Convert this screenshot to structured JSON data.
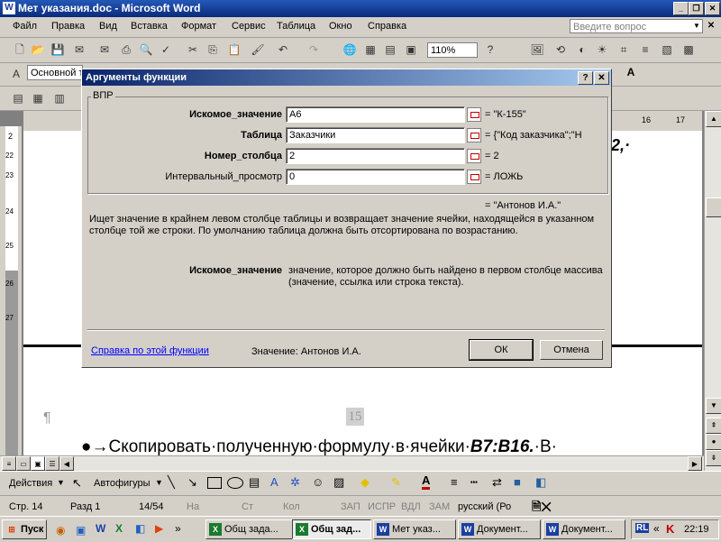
{
  "window": {
    "title": "Мет указания.doc - Microsoft Word",
    "app_icon": "W"
  },
  "menu": [
    "Файл",
    "Правка",
    "Вид",
    "Вставка",
    "Формат",
    "Сервис",
    "Таблица",
    "Окно",
    "Справка"
  ],
  "help_box": {
    "placeholder": "Введите вопрос"
  },
  "toolbar": {
    "zoom": "110%",
    "style": "Основной т"
  },
  "ruler": {
    "h_marks": [
      "16",
      "17"
    ],
    "v_marks": [
      "2",
      "22",
      "23",
      "24",
      "25",
      "26",
      "27"
    ]
  },
  "document": {
    "visible_fragment": "2,·",
    "paragraph_mark": "¶",
    "page_number": "15",
    "bullet_text": "●→Скопировать·полученную·формулу·в·ячейки·",
    "bullet_bold": "B7:B16.",
    "bullet_tail": "·В·"
  },
  "dialog": {
    "title": "Аргументы функции",
    "function_name": "ВПР",
    "args": [
      {
        "label": "Искомое_значение",
        "bold": true,
        "value": "A6",
        "result": "= \"К-155\""
      },
      {
        "label": "Таблица",
        "bold": true,
        "value": "Заказчики",
        "result": "= {\"Код заказчика\";\"Н"
      },
      {
        "label": "Номер_столбца",
        "bold": true,
        "value": "2",
        "result": "= 2"
      },
      {
        "label": "Интервальный_просмотр",
        "bold": false,
        "value": "0",
        "result": "= ЛОЖЬ"
      }
    ],
    "formula_result": "= \"Антонов И.А.\"",
    "description": "Ищет значение в крайнем левом столбце таблицы и возвращает значение ячейки, находящейся в указанном столбце той же строки. По умолчанию таблица должна быть отсортирована по возрастанию.",
    "arg_help_name": "Искомое_значение",
    "arg_help_text": "значение, которое должно быть найдено в первом столбце массива (значение, ссылка или строка текста).",
    "help_link": "Справка по этой функции",
    "value_label": "Значение:",
    "value": "Антонов И.А.",
    "ok": "ОК",
    "cancel": "Отмена"
  },
  "drawbar": {
    "actions": "Действия",
    "autoshapes": "Автофигуры"
  },
  "status": {
    "page": "Стр. 14",
    "section": "Разд 1",
    "pages": "14/54",
    "at": "На",
    "line": "Ст",
    "col": "Кол",
    "rec": "ЗАП",
    "trk": "ИСПР",
    "ext": "ВДЛ",
    "ovr": "ЗАМ",
    "lang": "русский (Ро"
  },
  "taskbar": {
    "start": "Пуск",
    "buttons": [
      {
        "label": "Общ зада...",
        "icon": "excel",
        "active": false
      },
      {
        "label": "Общ зад...",
        "icon": "excel",
        "active": true
      },
      {
        "label": "Мет указ...",
        "icon": "word",
        "active": false
      },
      {
        "label": "Документ...",
        "icon": "word",
        "active": false
      },
      {
        "label": "Документ...",
        "icon": "word",
        "active": false
      }
    ],
    "lang": "RL",
    "clock": "22:19"
  },
  "colors": {
    "title_bar": "#0a246a",
    "face": "#d4d0c8",
    "link": "#0000ff"
  }
}
